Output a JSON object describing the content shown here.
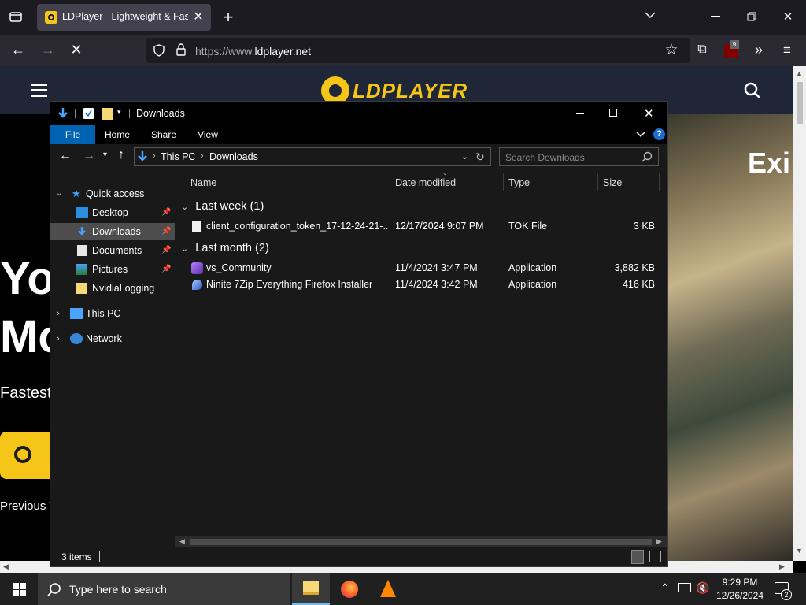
{
  "browser": {
    "tab_title": "LDPlayer - Lightweight & Fast Android Emulator",
    "url_scheme": "https://www.",
    "url_host": "ldplayer.net",
    "extension_badge": "9"
  },
  "site": {
    "logo_text": "LDPLAYER",
    "hero_line1": "Yo",
    "hero_line2": "Mo",
    "hero_sub": "Fastest",
    "hero_prev": "Previous V",
    "art_text": "Exi"
  },
  "explorer": {
    "title": "Downloads",
    "ribbon_tabs": [
      "File",
      "Home",
      "Share",
      "View"
    ],
    "breadcrumb": [
      "This PC",
      "Downloads"
    ],
    "search_placeholder": "Search Downloads",
    "nav": {
      "quick_access": "Quick access",
      "desktop": "Desktop",
      "downloads": "Downloads",
      "documents": "Documents",
      "pictures": "Pictures",
      "nvidialogging": "NvidiaLogging",
      "this_pc": "This PC",
      "network": "Network"
    },
    "columns": {
      "name": "Name",
      "date": "Date modified",
      "type": "Type",
      "size": "Size"
    },
    "groups": [
      {
        "label": "Last week (1)"
      },
      {
        "label": "Last month (2)"
      }
    ],
    "files": [
      {
        "name": "client_configuration_token_17-12-24-21-...",
        "date": "12/17/2024 9:07 PM",
        "type": "TOK File",
        "size": "3 KB"
      },
      {
        "name": "vs_Community",
        "date": "11/4/2024 3:47 PM",
        "type": "Application",
        "size": "3,882 KB"
      },
      {
        "name": "Ninite 7Zip Everything Firefox Installer",
        "date": "11/4/2024 3:42 PM",
        "type": "Application",
        "size": "416 KB"
      }
    ],
    "status_count": "3 items"
  },
  "taskbar": {
    "search_placeholder": "Type here to search",
    "time": "9:29 PM",
    "date": "12/26/2024",
    "notification_count": "2"
  }
}
